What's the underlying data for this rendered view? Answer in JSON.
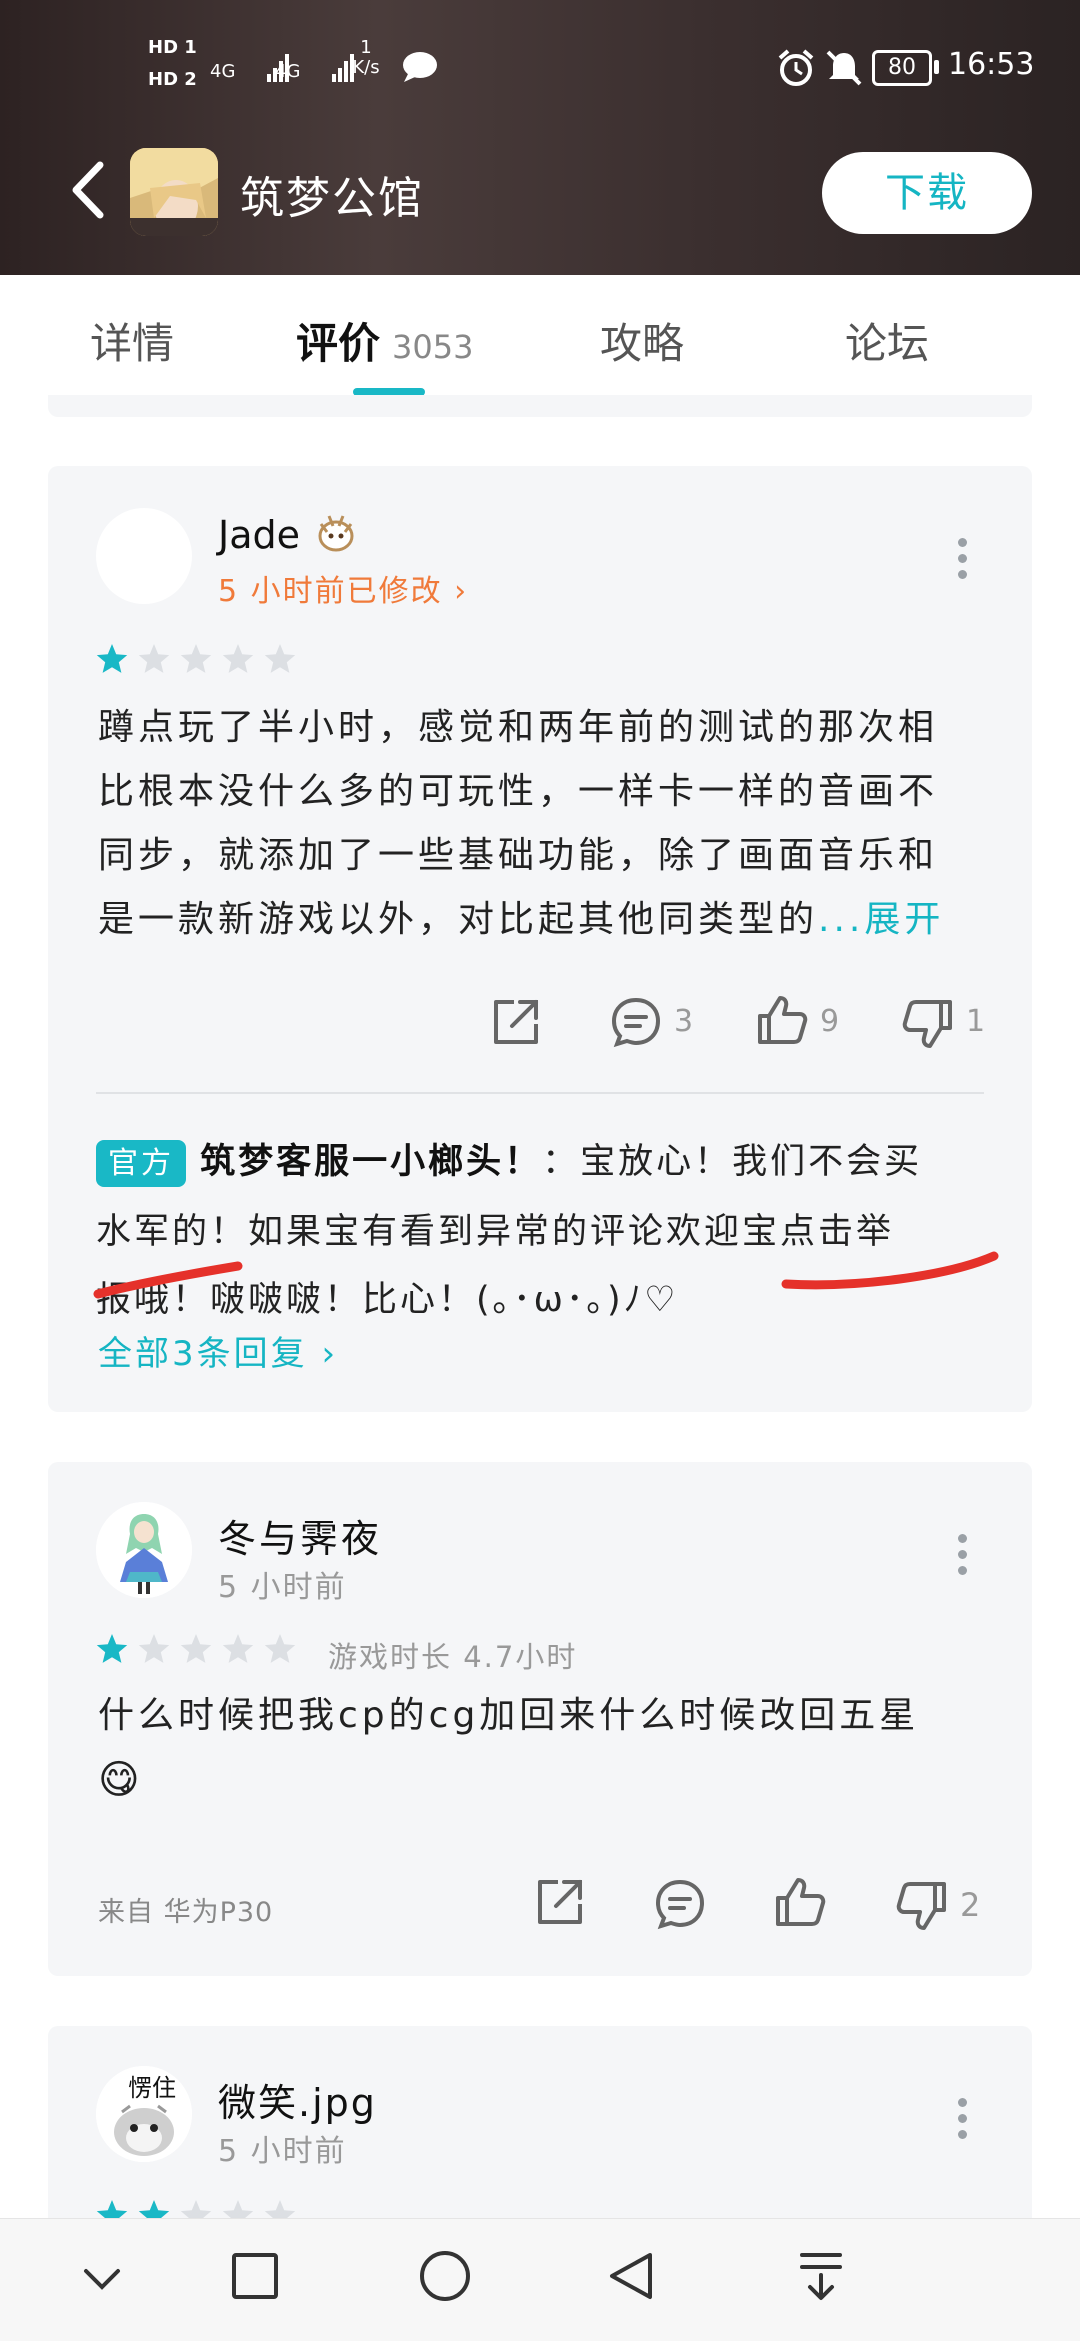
{
  "status_bar": {
    "hd1": "HD 1",
    "hd2": "HD 2",
    "net1": "4G",
    "net2": "4G",
    "speed_value": "1",
    "speed_unit": "K/s",
    "battery": "80",
    "time": "16:53"
  },
  "header": {
    "title": "筑梦公馆",
    "download_label": "下载"
  },
  "tabs": [
    {
      "label": "详情"
    },
    {
      "label": "评价",
      "count": "3053"
    },
    {
      "label": "攻略"
    },
    {
      "label": "论坛"
    }
  ],
  "reviews": [
    {
      "username": "Jade",
      "time": "5 小时前已修改 ›",
      "stars": 1,
      "text_lines": [
        "蹲点玩了半小时，感觉和两年前的测试的那次相",
        "比根本没什么多的可玩性，一样卡一样的音画不",
        "同步，就添加了一些基础功能，除了画面音乐和",
        "是一款新游戏以外，对比起其他同类型的"
      ],
      "ellipsis": "...",
      "expand_label": "展开",
      "comments": "3",
      "likes": "9",
      "dislikes": "1",
      "reply": {
        "badge": "官方",
        "author": "筑梦客服一小榔头！",
        "line1": "：宝放心！我们不会买",
        "line2": "水军的！如果宝有看到异常的评论欢迎宝点击举",
        "line3": "报哦！啵啵啵！比心！(｡･ω･｡)ﾉ♡",
        "all_replies": "全部3条回复 ›"
      }
    },
    {
      "username": "冬与霁夜",
      "time": "5 小时前",
      "stars": 1,
      "playtime": "游戏时长 4.7小时",
      "text_lines": [
        "什么时候把我cp的cg加回来什么时候改回五星"
      ],
      "emoji": "😋",
      "device": "来自 华为P30",
      "dislikes": "2"
    },
    {
      "username": "微笑.jpg",
      "time": "5 小时前",
      "avatar_text": "愣住",
      "stars": 2
    }
  ],
  "colors": {
    "accent": "#19b8c6",
    "orange": "#f07a3a",
    "card": "#f5f6f8"
  }
}
